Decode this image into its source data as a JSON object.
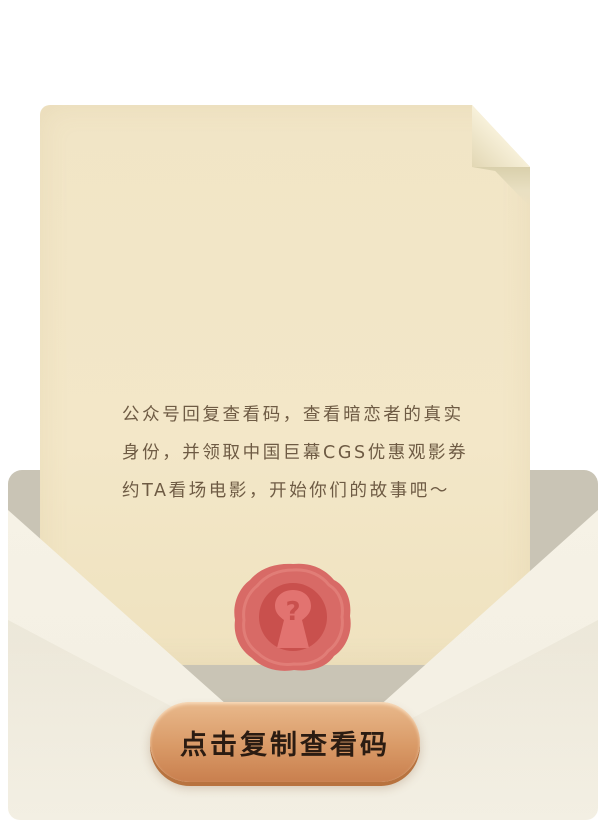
{
  "letter": {
    "message": "公众号回复查看码，查看暗恋者的真实身份，并领取中国巨幕CGS优惠观影券约TA看场电影，开始你们的故事吧～"
  },
  "seal": {
    "icon": "question-keyhole-icon",
    "color": "#d86a66"
  },
  "button": {
    "label": "点击复制查看码",
    "color": "#d99a67"
  }
}
